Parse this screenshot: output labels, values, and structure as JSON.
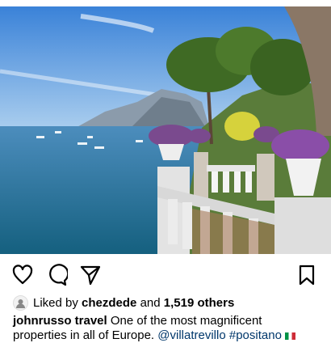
{
  "post": {
    "photo_alt": "",
    "actions": {
      "like_icon": "heart-icon",
      "comment_icon": "comment-icon",
      "share_icon": "paper-plane-icon",
      "save_icon": "bookmark-icon"
    },
    "likes": {
      "prefix": "Liked by",
      "user": "chezdede",
      "joiner": "and",
      "others": "1,519 others"
    },
    "caption": {
      "author": "johnrusso travel",
      "text_line1": "One of the most magnificent",
      "text_line2": "properties in all of Europe.",
      "mention": "@villatrevillo",
      "hashtag": "#positano",
      "flag": "italy-flag-emoji"
    }
  },
  "colors": {
    "link": "#00376b",
    "text": "#000000",
    "sky_top": "#3a82d8",
    "sea": "#1f6fa3"
  }
}
